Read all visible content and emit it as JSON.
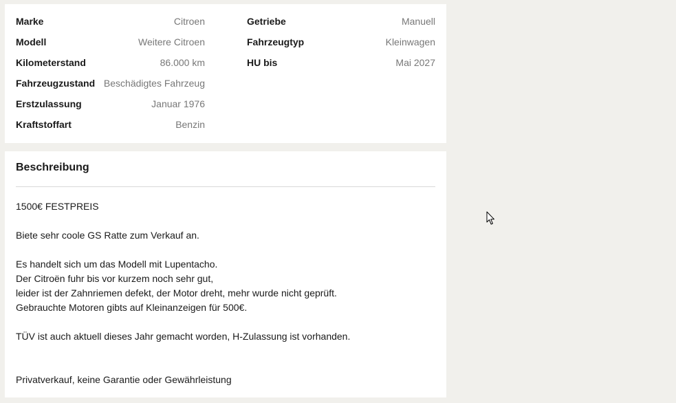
{
  "details": {
    "left": [
      {
        "label": "Marke",
        "value": "Citroen"
      },
      {
        "label": "Modell",
        "value": "Weitere Citroen"
      },
      {
        "label": "Kilometerstand",
        "value": "86.000 km"
      },
      {
        "label": "Fahrzeugzustand",
        "value": "Beschädigtes Fahrzeug"
      },
      {
        "label": "Erstzulassung",
        "value": "Januar 1976"
      },
      {
        "label": "Kraftstoffart",
        "value": "Benzin"
      }
    ],
    "right": [
      {
        "label": "Getriebe",
        "value": "Manuell"
      },
      {
        "label": "Fahrzeugtyp",
        "value": "Kleinwagen"
      },
      {
        "label": "HU bis",
        "value": "Mai 2027"
      }
    ]
  },
  "description": {
    "title": "Beschreibung",
    "lines": [
      "1500€ FESTPREIS",
      "",
      "Biete sehr coole GS Ratte zum Verkauf an.",
      "",
      "Es handelt sich um das Modell mit Lupentacho.",
      "Der Citroën fuhr bis vor kurzem noch sehr gut,",
      "leider ist der Zahnriemen defekt, der Motor dreht, mehr wurde nicht geprüft.",
      "Gebrauchte Motoren gibts auf Kleinanzeigen für 500€.",
      "",
      "TÜV ist auch aktuell dieses Jahr gemacht worden, H-Zulassung ist vorhanden.",
      "",
      "",
      "Privatverkauf, keine Garantie oder Gewährleistung"
    ]
  },
  "cursor_icon": "mouse-pointer-icon"
}
